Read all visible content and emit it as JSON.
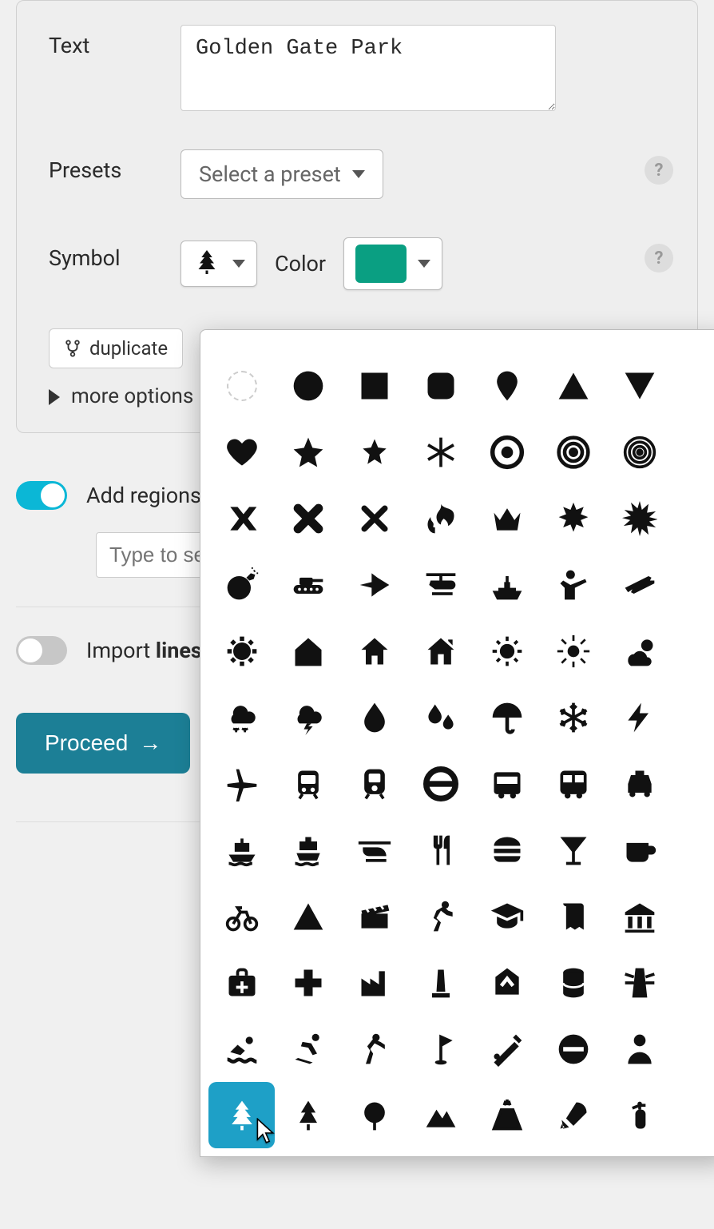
{
  "form": {
    "text_label": "Text",
    "text_value": "Golden Gate Park",
    "presets_label": "Presets",
    "presets_placeholder": "Select a preset",
    "symbol_label": "Symbol",
    "color_label": "Color",
    "color_hex": "#0a9f82",
    "duplicate": "duplicate",
    "more_options": "more options"
  },
  "controls": {
    "add_regions_label": "Add regions",
    "add_regions_on": true,
    "region_search_placeholder": "Type to search",
    "import_lines_label_part1": "Import ",
    "import_lines_label_part2": "lines",
    "import_lines_on": false,
    "proceed": "Proceed"
  },
  "symbols": {
    "selected": "tree",
    "grid": [
      [
        "none",
        "circle",
        "square",
        "rounded-square",
        "pin",
        "triangle-up",
        "triangle-down"
      ],
      [
        "heart",
        "star",
        "star-alt",
        "asterisk",
        "target",
        "bullseye",
        "spiral"
      ],
      [
        "x-bold",
        "x",
        "x-thin",
        "fire",
        "crown",
        "burst",
        "burst-alt"
      ],
      [
        "bomb",
        "tank",
        "jet",
        "helicopter",
        "ship-mil",
        "soldier",
        "rifle"
      ],
      [
        "virus",
        "house",
        "home",
        "chimney-house",
        "sun",
        "sun-alt",
        "cloud-sun"
      ],
      [
        "snow",
        "storm",
        "drop",
        "drops",
        "umbrella",
        "snowflake",
        "bolt"
      ],
      [
        "plane",
        "subway",
        "train",
        "tube",
        "bus",
        "bus-alt",
        "taxi"
      ],
      [
        "boat",
        "ferry",
        "heli-side",
        "utensils",
        "burger",
        "cocktail",
        "coffee"
      ],
      [
        "bike",
        "camp",
        "clapper",
        "run",
        "grad",
        "book",
        "museum"
      ],
      [
        "medkit",
        "plus",
        "factory",
        "monument",
        "metro",
        "barrel",
        "lighthouse"
      ],
      [
        "swim",
        "ski",
        "walk",
        "golf",
        "bat",
        "no-entry",
        "person"
      ],
      [
        "tree",
        "tree-alt",
        "tree-round",
        "mountain",
        "volcano",
        "rocket",
        "extinguisher"
      ]
    ]
  }
}
